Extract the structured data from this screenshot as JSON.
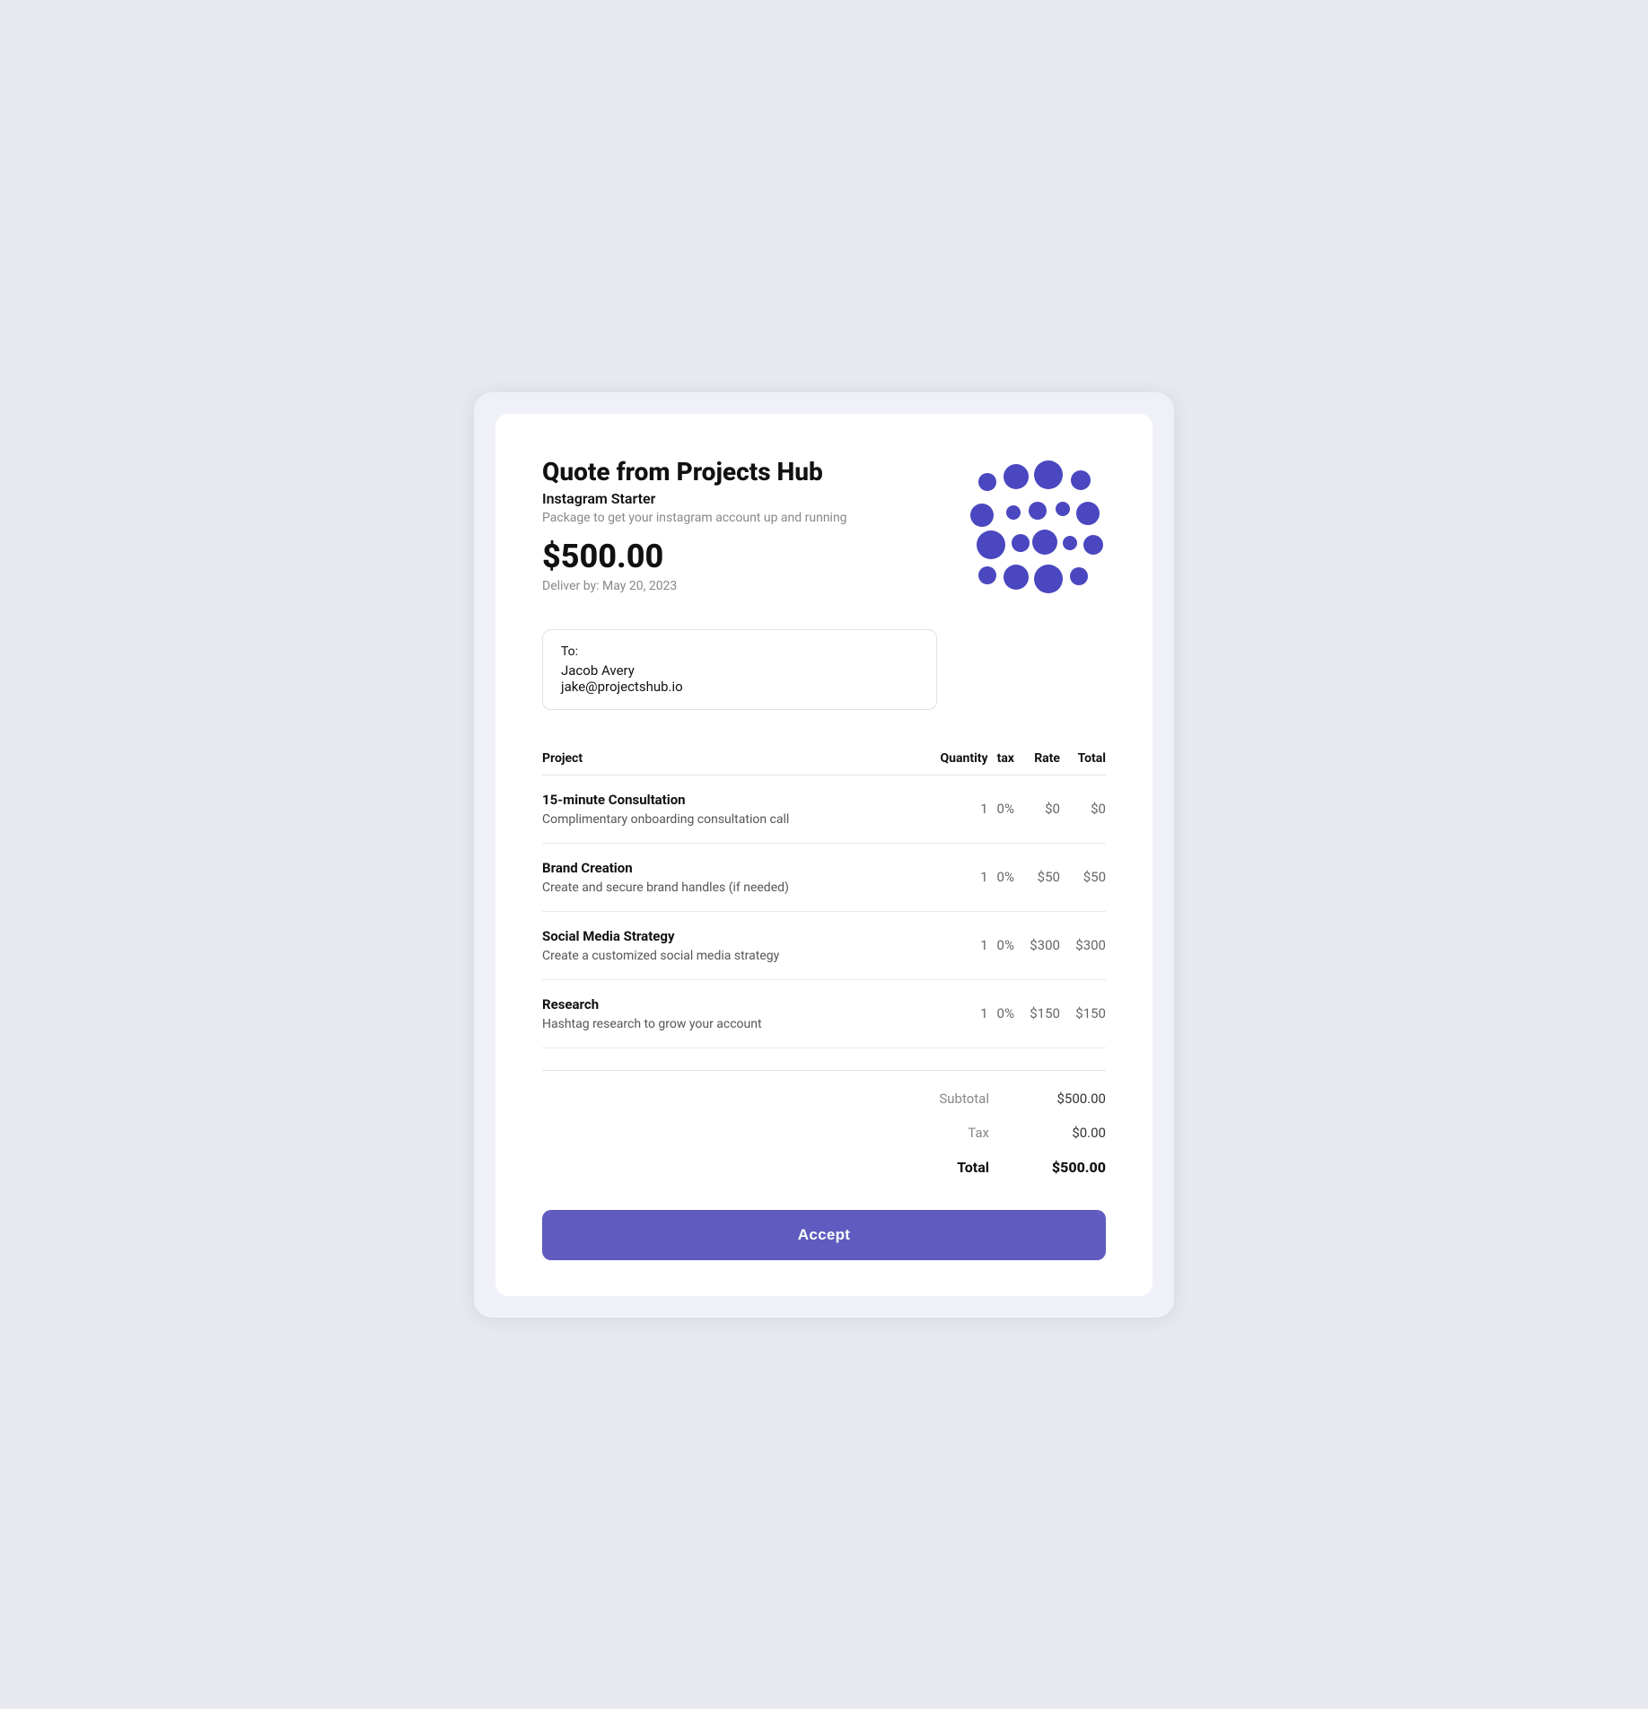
{
  "page": {
    "bg_color": "#e8e8f0"
  },
  "header": {
    "title": "Quote from Projects Hub",
    "package_name": "Instagram Starter",
    "package_desc": "Package to get your instagram account up and running",
    "price": "$500.00",
    "deliver_by": "Deliver by: May 20, 2023"
  },
  "recipient": {
    "label": "To:",
    "name": "Jacob Avery",
    "email": "jake@projectshub.io"
  },
  "table": {
    "columns": {
      "project": "Project",
      "quantity": "Quantity",
      "tax": "tax",
      "rate": "Rate",
      "total": "Total"
    },
    "rows": [
      {
        "name": "15-minute Consultation",
        "desc": "Complimentary onboarding consultation call",
        "quantity": "1",
        "tax": "0%",
        "rate": "$0",
        "total": "$0"
      },
      {
        "name": "Brand Creation",
        "desc": "Create and secure brand handles (if needed)",
        "quantity": "1",
        "tax": "0%",
        "rate": "$50",
        "total": "$50"
      },
      {
        "name": "Social Media Strategy",
        "desc": "Create a customized social media strategy",
        "quantity": "1",
        "tax": "0%",
        "rate": "$300",
        "total": "$300"
      },
      {
        "name": "Research",
        "desc": "Hashtag research to grow your account",
        "quantity": "1",
        "tax": "0%",
        "rate": "$150",
        "total": "$150"
      }
    ]
  },
  "totals": {
    "subtotal_label": "Subtotal",
    "subtotal_value": "$500.00",
    "tax_label": "Tax",
    "tax_value": "$0.00",
    "total_label": "Total",
    "total_value": "$500.00"
  },
  "accept_button": {
    "label": "Accept"
  },
  "logo": {
    "color": "#4a47c0"
  }
}
